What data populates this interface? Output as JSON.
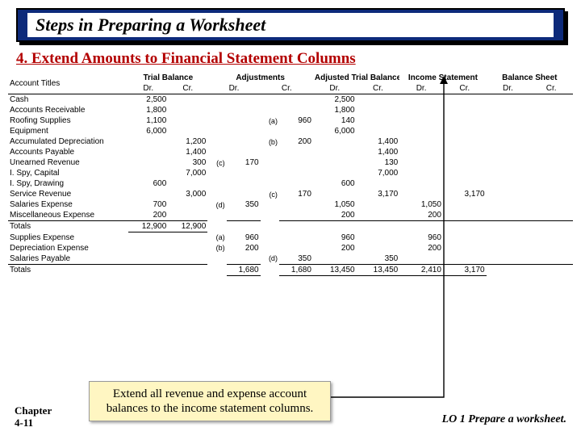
{
  "header": {
    "title": "Steps in Preparing a Worksheet",
    "step": "4. Extend Amounts to Financial Statement Columns"
  },
  "columns": {
    "account_titles": "Account Titles",
    "groups": [
      "Trial Balance",
      "Adjustments",
      "Adjusted Trial Balance",
      "Income Statement",
      "Balance Sheet"
    ],
    "sub": [
      "Dr.",
      "Cr."
    ]
  },
  "rows": [
    {
      "acc": "Cash",
      "tb_dr": "2,500",
      "tb_cr": "",
      "adj_l": "",
      "adj_dr": "",
      "adj_l2": "",
      "adj_cr": "",
      "atb_dr": "2,500",
      "atb_cr": "",
      "is_dr": "",
      "is_cr": "",
      "bs_dr": "",
      "bs_cr": ""
    },
    {
      "acc": "Accounts Receivable",
      "tb_dr": "1,800",
      "tb_cr": "",
      "adj_l": "",
      "adj_dr": "",
      "adj_l2": "",
      "adj_cr": "",
      "atb_dr": "1,800",
      "atb_cr": "",
      "is_dr": "",
      "is_cr": "",
      "bs_dr": "",
      "bs_cr": ""
    },
    {
      "acc": "Roofing Supplies",
      "tb_dr": "1,100",
      "tb_cr": "",
      "adj_l": "",
      "adj_dr": "",
      "adj_l2": "(a)",
      "adj_cr": "960",
      "atb_dr": "140",
      "atb_cr": "",
      "is_dr": "",
      "is_cr": "",
      "bs_dr": "",
      "bs_cr": ""
    },
    {
      "acc": "Equipment",
      "tb_dr": "6,000",
      "tb_cr": "",
      "adj_l": "",
      "adj_dr": "",
      "adj_l2": "",
      "adj_cr": "",
      "atb_dr": "6,000",
      "atb_cr": "",
      "is_dr": "",
      "is_cr": "",
      "bs_dr": "",
      "bs_cr": ""
    },
    {
      "acc": "Accumulated Depreciation",
      "tb_dr": "",
      "tb_cr": "1,200",
      "adj_l": "",
      "adj_dr": "",
      "adj_l2": "(b)",
      "adj_cr": "200",
      "atb_dr": "",
      "atb_cr": "1,400",
      "is_dr": "",
      "is_cr": "",
      "bs_dr": "",
      "bs_cr": ""
    },
    {
      "acc": "Accounts Payable",
      "tb_dr": "",
      "tb_cr": "1,400",
      "adj_l": "",
      "adj_dr": "",
      "adj_l2": "",
      "adj_cr": "",
      "atb_dr": "",
      "atb_cr": "1,400",
      "is_dr": "",
      "is_cr": "",
      "bs_dr": "",
      "bs_cr": ""
    },
    {
      "acc": "Unearned Revenue",
      "tb_dr": "",
      "tb_cr": "300",
      "adj_l": "(c)",
      "adj_dr": "170",
      "adj_l2": "",
      "adj_cr": "",
      "atb_dr": "",
      "atb_cr": "130",
      "is_dr": "",
      "is_cr": "",
      "bs_dr": "",
      "bs_cr": ""
    },
    {
      "acc": "I. Spy, Capital",
      "tb_dr": "",
      "tb_cr": "7,000",
      "adj_l": "",
      "adj_dr": "",
      "adj_l2": "",
      "adj_cr": "",
      "atb_dr": "",
      "atb_cr": "7,000",
      "is_dr": "",
      "is_cr": "",
      "bs_dr": "",
      "bs_cr": ""
    },
    {
      "acc": "I. Spy, Drawing",
      "tb_dr": "600",
      "tb_cr": "",
      "adj_l": "",
      "adj_dr": "",
      "adj_l2": "",
      "adj_cr": "",
      "atb_dr": "600",
      "atb_cr": "",
      "is_dr": "",
      "is_cr": "",
      "bs_dr": "",
      "bs_cr": ""
    },
    {
      "acc": "Service Revenue",
      "tb_dr": "",
      "tb_cr": "3,000",
      "adj_l": "",
      "adj_dr": "",
      "adj_l2": "(c)",
      "adj_cr": "170",
      "atb_dr": "",
      "atb_cr": "3,170",
      "is_dr": "",
      "is_cr": "3,170",
      "bs_dr": "",
      "bs_cr": ""
    },
    {
      "acc": "Salaries Expense",
      "tb_dr": "700",
      "tb_cr": "",
      "adj_l": "(d)",
      "adj_dr": "350",
      "adj_l2": "",
      "adj_cr": "",
      "atb_dr": "1,050",
      "atb_cr": "",
      "is_dr": "1,050",
      "is_cr": "",
      "bs_dr": "",
      "bs_cr": ""
    },
    {
      "acc": "Miscellaneous Expense",
      "tb_dr": "200",
      "tb_cr": "",
      "adj_l": "",
      "adj_dr": "",
      "adj_l2": "",
      "adj_cr": "",
      "atb_dr": "200",
      "atb_cr": "",
      "is_dr": "200",
      "is_cr": "",
      "bs_dr": "",
      "bs_cr": ""
    },
    {
      "acc": "Totals",
      "tb_dr": "12,900",
      "tb_cr": "12,900",
      "adj_l": "",
      "adj_dr": "",
      "adj_l2": "",
      "adj_cr": "",
      "atb_dr": "",
      "atb_cr": "",
      "is_dr": "",
      "is_cr": "",
      "bs_dr": "",
      "bs_cr": "",
      "totals1": true
    },
    {
      "acc": "Supplies Expense",
      "tb_dr": "",
      "tb_cr": "",
      "adj_l": "(a)",
      "adj_dr": "960",
      "adj_l2": "",
      "adj_cr": "",
      "atb_dr": "960",
      "atb_cr": "",
      "is_dr": "960",
      "is_cr": "",
      "bs_dr": "",
      "bs_cr": ""
    },
    {
      "acc": "Depreciation Expense",
      "tb_dr": "",
      "tb_cr": "",
      "adj_l": "(b)",
      "adj_dr": "200",
      "adj_l2": "",
      "adj_cr": "",
      "atb_dr": "200",
      "atb_cr": "",
      "is_dr": "200",
      "is_cr": "",
      "bs_dr": "",
      "bs_cr": ""
    },
    {
      "acc": "Salaries Payable",
      "tb_dr": "",
      "tb_cr": "",
      "adj_l": "",
      "adj_dr": "",
      "adj_l2": "(d)",
      "adj_cr": "350",
      "atb_dr": "",
      "atb_cr": "350",
      "is_dr": "",
      "is_cr": "",
      "bs_dr": "",
      "bs_cr": ""
    },
    {
      "acc": "Totals",
      "tb_dr": "",
      "tb_cr": "",
      "adj_l": "",
      "adj_dr": "1,680",
      "adj_l2": "",
      "adj_cr": "1,680",
      "atb_dr": "13,450",
      "atb_cr": "13,450",
      "is_dr": "2,410",
      "is_cr": "3,170",
      "bs_dr": "",
      "bs_cr": "",
      "totals2": true
    }
  ],
  "callout": "Extend all revenue and expense account balances to the income statement columns.",
  "footer": {
    "chapter_a": "Chapter",
    "chapter_b": "4-11",
    "lo": "LO 1   Prepare a worksheet."
  }
}
